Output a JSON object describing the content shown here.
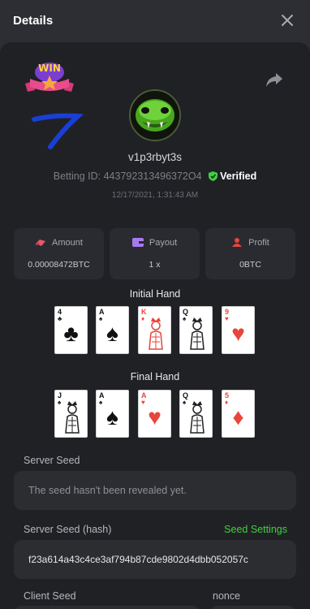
{
  "header": {
    "title": "Details"
  },
  "profile": {
    "username": "v1p3rbyt3s",
    "betting_id_label": "Betting ID:",
    "betting_id": "443792313496372O4",
    "verified": "Verified",
    "date": "12/17/2021, 1:31:43 AM"
  },
  "badge": {
    "text": "WIN"
  },
  "stats": [
    {
      "label": "Amount",
      "value": "0.00008472BTC"
    },
    {
      "label": "Payout",
      "value": "1 x"
    },
    {
      "label": "Profit",
      "value": "0BTC"
    }
  ],
  "initial_hand": {
    "label": "Initial Hand",
    "cards": [
      {
        "rank": "4",
        "suit": "♣",
        "color": "black"
      },
      {
        "rank": "A",
        "suit": "♠",
        "color": "black"
      },
      {
        "rank": "K",
        "suit": "♦",
        "color": "red"
      },
      {
        "rank": "Q",
        "suit": "♠",
        "color": "black"
      },
      {
        "rank": "9",
        "suit": "♥",
        "color": "red"
      }
    ]
  },
  "final_hand": {
    "label": "Final Hand",
    "cards": [
      {
        "rank": "J",
        "suit": "♠",
        "color": "black"
      },
      {
        "rank": "A",
        "suit": "♠",
        "color": "black"
      },
      {
        "rank": "A",
        "suit": "♥",
        "color": "red"
      },
      {
        "rank": "Q",
        "suit": "♠",
        "color": "black"
      },
      {
        "rank": "5",
        "suit": "♦",
        "color": "red"
      }
    ]
  },
  "server_seed": {
    "label": "Server Seed",
    "value": "The seed hasn't been revealed yet."
  },
  "server_seed_hash": {
    "label": "Server Seed (hash)",
    "link": "Seed Settings",
    "value": "f23a614a43c4ce3af794b87cde9802d4dbb052057c"
  },
  "client_seed": {
    "label": "Client Seed"
  },
  "nonce": {
    "label": "nonce"
  },
  "colors": {
    "background": "#202125",
    "header": "#2d2e33",
    "card_panel": "#2a2b30",
    "accent_green": "#3fd13f",
    "amount_icon": "#e9576a",
    "payout_icon": "#a77bf0",
    "profit_icon": "#e8453c"
  }
}
